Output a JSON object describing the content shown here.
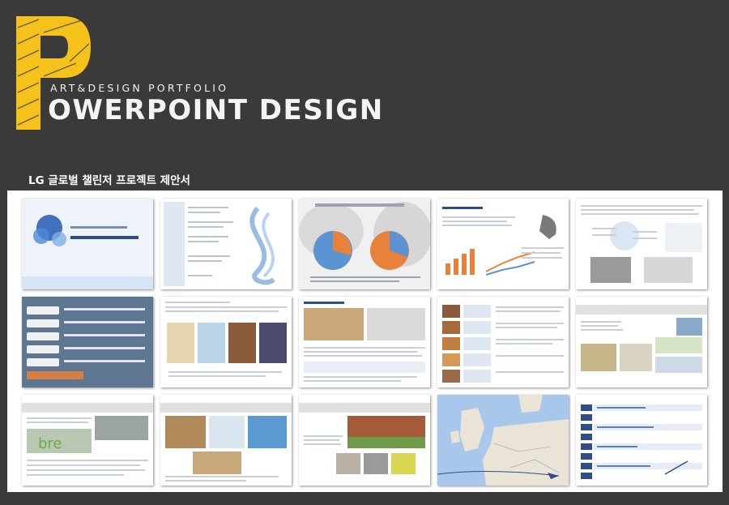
{
  "header": {
    "logo_letter": "P",
    "tagline": "ART&DESIGN PORTFOLIO",
    "title": "OWERPOINT DESIGN"
  },
  "section": {
    "title": "LG 글로벌 챌린저 프로젝트 제안서"
  },
  "colors": {
    "background": "#3a3a3a",
    "logo_yellow": "#f5c21b",
    "frame": "#ffffff",
    "accent_blue": "#2c4f8c",
    "accent_orange": "#e8823a"
  },
  "slides": [
    {
      "label": "slide-cover"
    },
    {
      "label": "slide-agenda"
    },
    {
      "label": "slide-survey-pie"
    },
    {
      "label": "slide-background-chart"
    },
    {
      "label": "slide-concept"
    },
    {
      "label": "slide-list-blue"
    },
    {
      "label": "slide-posters"
    },
    {
      "label": "slide-hospital-photos"
    },
    {
      "label": "slide-image-rows"
    },
    {
      "label": "slide-visit-1"
    },
    {
      "label": "slide-visit-bre"
    },
    {
      "label": "slide-visit-rooms"
    },
    {
      "label": "slide-visit-building"
    },
    {
      "label": "slide-route-map"
    },
    {
      "label": "slide-schedule"
    }
  ]
}
